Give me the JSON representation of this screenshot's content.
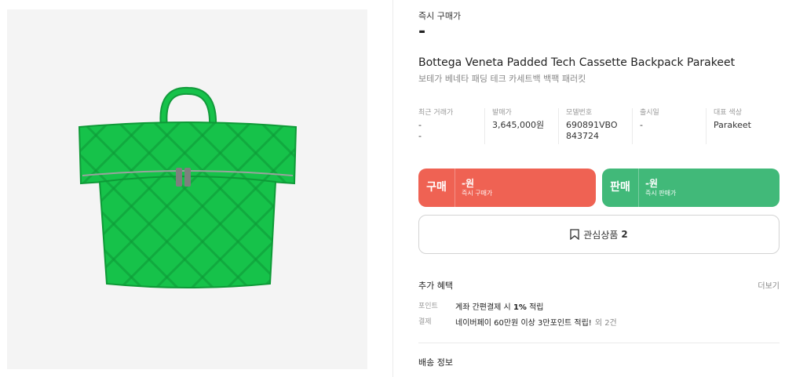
{
  "product": {
    "image_alt": "Green quilted woven padded backpack",
    "instant_price_label": "즉시 구매가",
    "instant_price_value": "-",
    "title_en": "Bottega Veneta Padded Tech Cassette Backpack Parakeet",
    "title_ko": "보테가 베네타 패딩 테크 카세트백 백팩 패러킷"
  },
  "details": [
    {
      "label": "최근 거래가",
      "value": "-",
      "sub": "-"
    },
    {
      "label": "발매가",
      "value": "3,645,000원",
      "sub": ""
    },
    {
      "label": "모델번호",
      "value": "690891VBO843724",
      "sub": ""
    },
    {
      "label": "출시일",
      "value": "-",
      "sub": ""
    },
    {
      "label": "대표 색상",
      "value": "Parakeet",
      "sub": ""
    }
  ],
  "buy_button": {
    "label": "구매",
    "price": "-원",
    "sub": "즉시 구매가",
    "color": "#ef6253"
  },
  "sell_button": {
    "label": "판매",
    "price": "-원",
    "sub": "즉시 판매가",
    "color": "#41b979"
  },
  "wishlist": {
    "label": "관심상품",
    "count": "2",
    "icon": "bookmark-icon"
  },
  "benefits": {
    "title": "추가 혜택",
    "more": "더보기",
    "rows": [
      {
        "label": "포인트",
        "text_prefix": "계좌 간편결제 시 ",
        "text_bold": "1%",
        "text_suffix": " 적립",
        "extra": ""
      },
      {
        "label": "결제",
        "text_prefix": "네이버페이 60만원 이상 3만포인트 적립!",
        "text_bold": "",
        "text_suffix": "",
        "extra": "외 2건"
      }
    ]
  },
  "shipping": {
    "title": "배송 정보"
  },
  "colors": {
    "bag": "#16c24a",
    "bag_dark": "#0e9a37",
    "panel_bg": "#f4f4f4"
  }
}
